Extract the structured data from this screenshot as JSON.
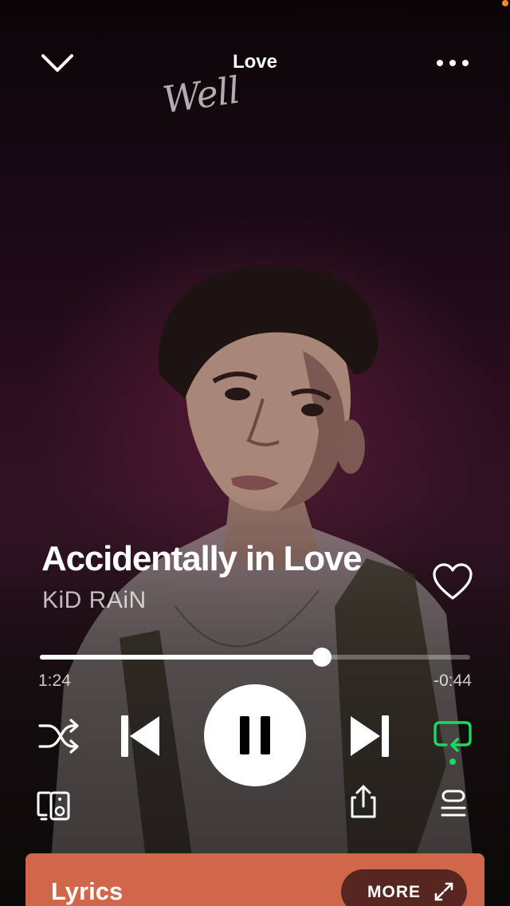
{
  "header": {
    "title": "Love",
    "collapse_icon": "chevron-down-icon",
    "more_icon": "more-horizontal-icon"
  },
  "artwork": {
    "overlay_text": "Well"
  },
  "track": {
    "title": "Accidentally in Love",
    "artist": "KiD RAiN",
    "liked": false
  },
  "progress": {
    "elapsed": "1:24",
    "remaining": "-0:44",
    "fraction": 0.656
  },
  "controls": {
    "shuffle_icon": "shuffle-icon",
    "previous_icon": "skip-previous-icon",
    "play_state_icon": "pause-icon",
    "next_icon": "skip-next-icon",
    "repeat_icon": "repeat-icon",
    "repeat_active": true,
    "devices_icon": "devices-icon",
    "share_icon": "share-icon",
    "queue_icon": "queue-icon"
  },
  "lyrics": {
    "title": "Lyrics",
    "more_label": "MORE",
    "expand_icon": "expand-icon"
  },
  "colors": {
    "accent_green": "#1ed760",
    "lyrics_card": "#d0674a",
    "status_dot": "#f08a24"
  }
}
